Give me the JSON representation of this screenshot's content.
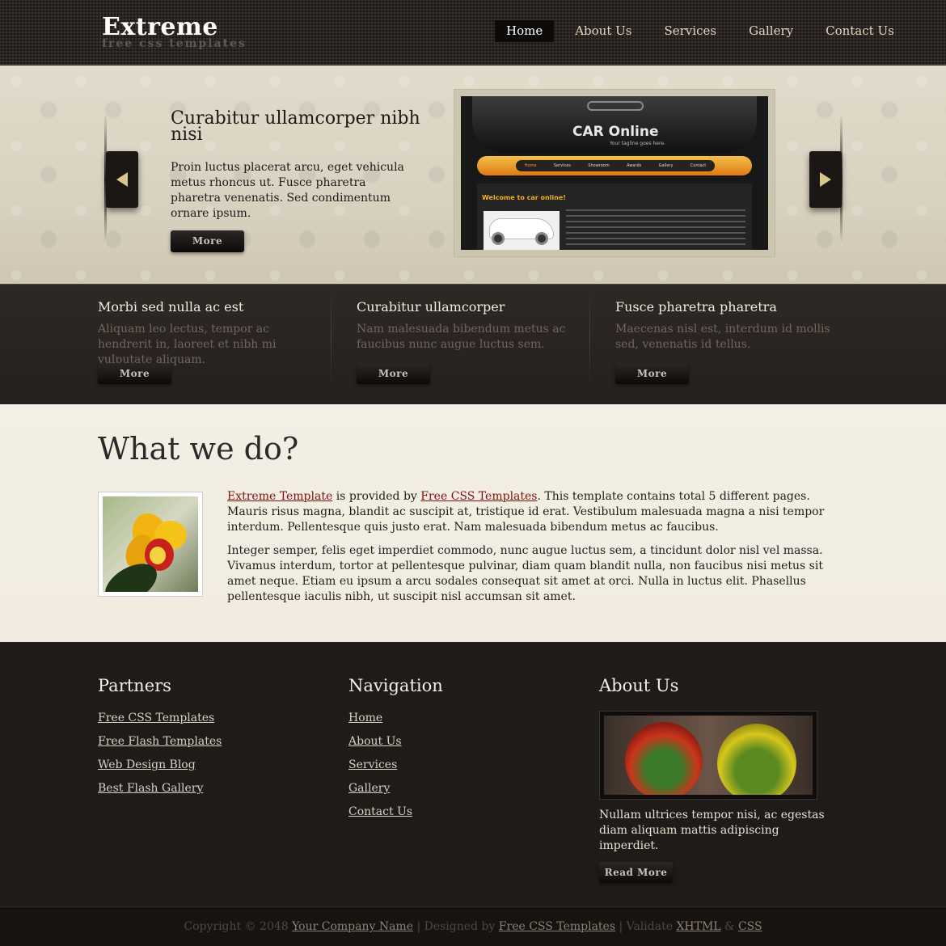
{
  "header": {
    "logo_title": "Extreme",
    "logo_subtitle": "free css templates",
    "nav": [
      {
        "label": "Home",
        "active": true
      },
      {
        "label": "About Us",
        "active": false
      },
      {
        "label": "Services",
        "active": false
      },
      {
        "label": "Gallery",
        "active": false
      },
      {
        "label": "Contact Us",
        "active": false
      }
    ]
  },
  "slider": {
    "title": "Curabitur ullamcorper nibh nisi",
    "text": "Proin luctus placerat arcu, eget vehicula metus rhoncus ut. Fusce pharetra pharetra venenatis. Sed condimentum ornare ipsum.",
    "button": "More",
    "arrows": {
      "prev": "arrow-left-icon",
      "next": "arrow-right-icon"
    },
    "screenshot": {
      "title": "CAR Online",
      "tagline": "Your tagline goes here.",
      "nav": [
        "Home",
        "Services",
        "Showroom",
        "Awards",
        "Gallery",
        "Contact"
      ],
      "welcome": "Welcome to car online!"
    }
  },
  "features": [
    {
      "title": "Morbi sed nulla ac est",
      "text": "Aliquam leo lectus, tempor ac hendrerit in, laoreet et nibh mi vulputate aliquam.",
      "button": "More"
    },
    {
      "title": "Curabitur ullamcorper",
      "text": "Nam malesuada bibendum metus ac faucibus nunc augue luctus sem.",
      "button": "More"
    },
    {
      "title": "Fusce pharetra pharetra",
      "text": "Maecenas nisl est, interdum id mollis sed, venenatis id tellus.",
      "button": "More"
    }
  ],
  "content": {
    "title": "What we do?",
    "link1": "Extreme Template",
    "mid1": " is provided by ",
    "link2": "Free CSS Templates",
    "rest1": ". This template contains total 5 different pages. Mauris risus magna, blandit ac suscipit at, tristique id erat. Vestibulum malesuada magna a nisi tempor interdum. Pellentesque quis justo erat. Nam malesuada bibendum metus ac faucibus.",
    "para2": "Integer semper, felis eget imperdiet commodo, nunc augue luctus sem, a tincidunt dolor nisl vel massa. Vivamus interdum, tortor at pellentesque pulvinar, diam quam blandit nulla, non faucibus nisi metus sit amet neque. Etiam eu ipsum a arcu sodales consequat sit amet at orci. Nulla in luctus elit. Phasellus pellentesque iaculis nibh, ut suscipit nisl accumsan sit amet."
  },
  "footer": {
    "partners": {
      "title": "Partners",
      "links": [
        "Free CSS Templates",
        "Free Flash Templates",
        "Web Design Blog",
        "Best Flash Gallery"
      ]
    },
    "navigation": {
      "title": "Navigation",
      "links": [
        "Home",
        "About Us",
        "Services",
        "Gallery",
        "Contact Us"
      ]
    },
    "about": {
      "title": "About Us",
      "text": "Nullam ultrices tempor nisi, ac egestas diam aliquam mattis adipiscing imperdiet.",
      "button": "Read More"
    }
  },
  "copyright": {
    "prefix": "Copyright © 2048 ",
    "company": "Your Company Name",
    "designed": " | Designed by ",
    "designer": "Free CSS Templates",
    "validate": " | Validate ",
    "xhtml": "XHTML",
    "amp": " & ",
    "css": "CSS"
  },
  "colors": {
    "header_bg": "#2a2522",
    "accent_link": "#7c1010",
    "content_bg": "#f3efe4",
    "footer_bg": "#1f1b18"
  }
}
